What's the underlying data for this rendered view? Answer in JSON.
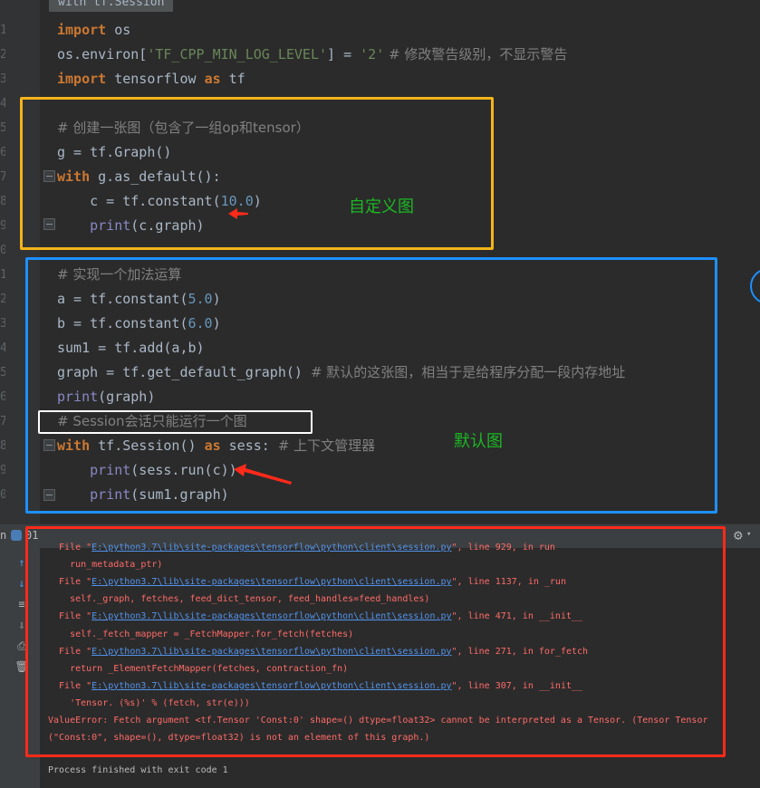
{
  "editor": {
    "tab_label": "with tf.Session",
    "line_numbers": [
      "1",
      "2",
      "3",
      "4",
      "5",
      "6",
      "7",
      "8",
      "9",
      "0",
      "1",
      "2",
      "3",
      "4",
      "5",
      "6",
      "7",
      "8",
      "9",
      "0"
    ],
    "lines": [
      [
        {
          "t": "import",
          "c": "kw"
        },
        {
          "t": " os"
        }
      ],
      [
        {
          "t": "os.environ["
        },
        {
          "t": "'TF_CPP_MIN_LOG_LEVEL'",
          "c": "str"
        },
        {
          "t": "] = "
        },
        {
          "t": "'2'",
          "c": "str"
        },
        {
          "t": " # 修改警告级别，不显示警告",
          "c": "cm"
        }
      ],
      [
        {
          "t": "import",
          "c": "kw"
        },
        {
          "t": " tensorflow "
        },
        {
          "t": "as",
          "c": "kw"
        },
        {
          "t": " tf"
        }
      ],
      [],
      [
        {
          "t": "# 创建一张图（包含了一组op和tensor）",
          "c": "cm"
        }
      ],
      [
        {
          "t": "g = tf.Graph()"
        }
      ],
      [
        {
          "t": "with",
          "c": "kw"
        },
        {
          "t": " g.as_default():"
        }
      ],
      [
        {
          "t": "    c = tf.constant("
        },
        {
          "t": "10.0",
          "c": "num"
        },
        {
          "t": ")"
        }
      ],
      [
        {
          "t": "    "
        },
        {
          "t": "print",
          "c": "fn"
        },
        {
          "t": "(c.graph)"
        }
      ],
      [],
      [
        {
          "t": "# 实现一个加法运算",
          "c": "cm"
        }
      ],
      [
        {
          "t": "a = tf.constant("
        },
        {
          "t": "5.0",
          "c": "num"
        },
        {
          "t": ")"
        }
      ],
      [
        {
          "t": "b = tf.constant("
        },
        {
          "t": "6.0",
          "c": "num"
        },
        {
          "t": ")"
        }
      ],
      [
        {
          "t": "sum1 = tf.add(a,b)"
        }
      ],
      [
        {
          "t": "graph = tf.get_default_graph() "
        },
        {
          "t": "# 默认的这张图，相当于是给程序分配一段内存地址",
          "c": "cm"
        }
      ],
      [
        {
          "t": "print",
          "c": "fn"
        },
        {
          "t": "(graph)"
        }
      ],
      [
        {
          "t": "# Session会话只能运行一个图",
          "c": "cm"
        }
      ],
      [
        {
          "t": "with",
          "c": "kw"
        },
        {
          "t": " tf.Session() "
        },
        {
          "t": "as",
          "c": "kw"
        },
        {
          "t": " sess: "
        },
        {
          "t": "# 上下文管理器",
          "c": "cm"
        }
      ],
      [
        {
          "t": "    "
        },
        {
          "t": "print",
          "c": "fn"
        },
        {
          "t": "(sess.run(c))"
        }
      ],
      [
        {
          "t": "    "
        },
        {
          "t": "print",
          "c": "fn"
        },
        {
          "t": "(sum1.graph)"
        }
      ]
    ]
  },
  "annotations": {
    "custom_graph_label": "自定义图",
    "default_graph_label": "默认图",
    "box_colors": {
      "yellow": "#f4b41a",
      "blue": "#1e90ff",
      "white": "#ffffff",
      "red": "#ff2a1a"
    },
    "arrow_color": "#ff2a1a"
  },
  "run_bar": {
    "tab_fragment": "n",
    "run_name": "01",
    "settings_icon": "gear-icon"
  },
  "console": {
    "lines": [
      [
        {
          "t": "  File \""
        },
        {
          "t": "E:\\python3.7\\lib\\site-packages\\tensorflow\\python\\client\\session.py",
          "c": "lnk"
        },
        {
          "t": "\", line 929, in run"
        }
      ],
      [
        {
          "t": "    run_metadata_ptr)"
        }
      ],
      [
        {
          "t": "  File \""
        },
        {
          "t": "E:\\python3.7\\lib\\site-packages\\tensorflow\\python\\client\\session.py",
          "c": "lnk"
        },
        {
          "t": "\", line 1137, in _run"
        }
      ],
      [
        {
          "t": "    self._graph, fetches, feed_dict_tensor, feed_handles=feed_handles)"
        }
      ],
      [
        {
          "t": "  File \""
        },
        {
          "t": "E:\\python3.7\\lib\\site-packages\\tensorflow\\python\\client\\session.py",
          "c": "lnk"
        },
        {
          "t": "\", line 471, in __init__"
        }
      ],
      [
        {
          "t": "    self._fetch_mapper = _FetchMapper.for_fetch(fetches)"
        }
      ],
      [
        {
          "t": "  File \""
        },
        {
          "t": "E:\\python3.7\\lib\\site-packages\\tensorflow\\python\\client\\session.py",
          "c": "lnk"
        },
        {
          "t": "\", line 271, in for_fetch"
        }
      ],
      [
        {
          "t": "    return _ElementFetchMapper(fetches, contraction_fn)"
        }
      ],
      [
        {
          "t": "  File \""
        },
        {
          "t": "E:\\python3.7\\lib\\site-packages\\tensorflow\\python\\client\\session.py",
          "c": "lnk"
        },
        {
          "t": "\", line 307, in __init__"
        }
      ],
      [
        {
          "t": "    'Tensor. (%s)' % (fetch, str(e)))"
        }
      ],
      [
        {
          "t": "ValueError: Fetch argument <tf.Tensor 'Const:0' shape=() dtype=float32> cannot be interpreted as a Tensor. (Tensor Tensor"
        }
      ],
      [
        {
          "t": "(\"Const:0\", shape=(), dtype=float32) is not an element of this graph.)"
        }
      ]
    ],
    "finished": "Process finished with exit code 1"
  },
  "toolbar_icons": [
    "rerun-icon",
    "scroll-down-icon",
    "soft-wrap-icon",
    "scroll-end-icon",
    "print-icon",
    "trash-icon"
  ],
  "toolbar_glyphs": [
    "↑",
    "↓",
    "≡",
    "⇩",
    "⎙",
    "🗑"
  ]
}
